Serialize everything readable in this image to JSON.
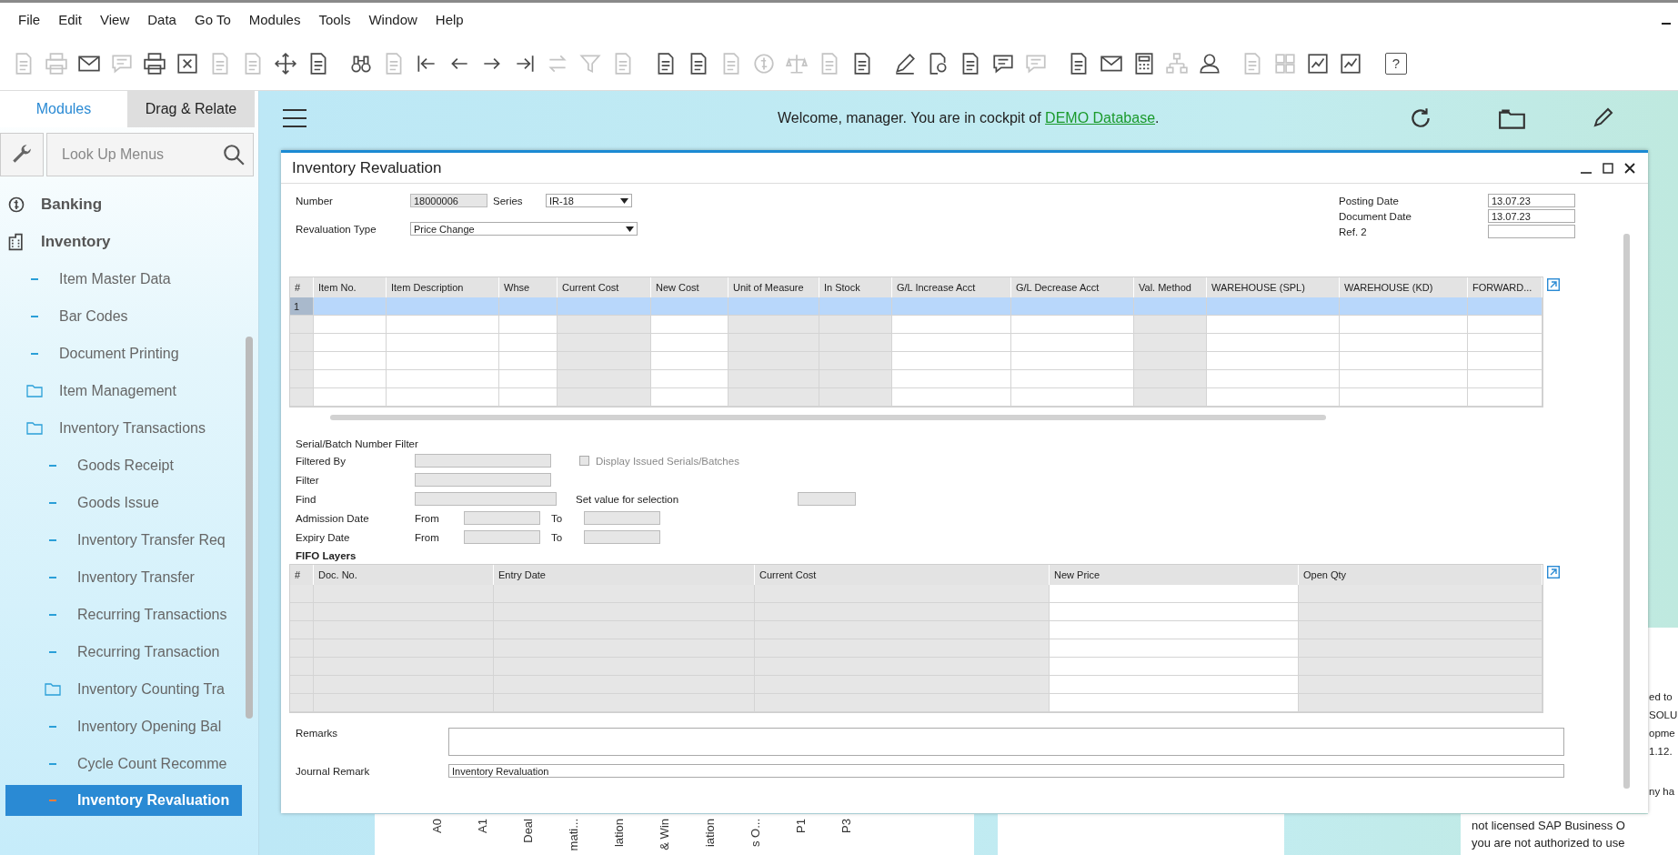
{
  "menu": [
    "File",
    "Edit",
    "View",
    "Data",
    "Go To",
    "Modules",
    "Tools",
    "Window",
    "Help"
  ],
  "toolbar": {
    "groups": [
      [
        {
          "disabled": true
        },
        {
          "disabled": true
        },
        {
          "disabled": false
        },
        {
          "disabled": true
        },
        {
          "disabled": false
        },
        {
          "disabled": false
        },
        {
          "disabled": true
        },
        {
          "disabled": true
        },
        {
          "disabled": false
        },
        {
          "disabled": false
        }
      ],
      [
        {
          "disabled": false
        },
        {
          "disabled": true
        },
        {
          "disabled": false
        },
        {
          "disabled": false
        },
        {
          "disabled": false
        },
        {
          "disabled": false
        },
        {
          "disabled": true
        },
        {
          "disabled": true
        },
        {
          "disabled": true
        }
      ],
      [
        {
          "disabled": false
        },
        {
          "disabled": false
        },
        {
          "disabled": true
        },
        {
          "disabled": true
        },
        {
          "disabled": true
        },
        {
          "disabled": true
        },
        {
          "disabled": false
        }
      ],
      [
        {
          "disabled": false
        },
        {
          "disabled": false
        },
        {
          "disabled": false
        },
        {
          "disabled": false
        },
        {
          "disabled": true
        }
      ],
      [
        {
          "disabled": false
        },
        {
          "disabled": false
        },
        {
          "disabled": false
        },
        {
          "disabled": true
        },
        {
          "disabled": false
        }
      ],
      [
        {
          "disabled": true
        },
        {
          "disabled": true
        },
        {
          "disabled": false
        },
        {
          "disabled": false
        }
      ],
      [
        {
          "disabled": false,
          "glyph": "?"
        }
      ]
    ]
  },
  "sidebar": {
    "tabs": [
      {
        "label": "Modules",
        "selected": true
      },
      {
        "label": "Drag & Relate",
        "selected": false
      }
    ],
    "search": {
      "placeholder": "Look Up Menus"
    },
    "modules": [
      {
        "label": "Banking",
        "kind": "coin",
        "selected": false
      },
      {
        "label": "Inventory",
        "kind": "building",
        "selected": false,
        "children": [
          {
            "label": "Item Master Data",
            "kind": "leaf",
            "selected": false
          },
          {
            "label": "Bar Codes",
            "kind": "leaf",
            "selected": false
          },
          {
            "label": "Document Printing",
            "kind": "leaf",
            "selected": false
          },
          {
            "label": "Item Management",
            "kind": "folder",
            "selected": false
          },
          {
            "label": "Inventory Transactions",
            "kind": "folder",
            "selected": false,
            "children": [
              {
                "label": "Goods Receipt",
                "kind": "leaf",
                "selected": false
              },
              {
                "label": "Goods Issue",
                "kind": "leaf",
                "selected": false
              },
              {
                "label": "Inventory Transfer Req",
                "kind": "leaf",
                "selected": false
              },
              {
                "label": "Inventory Transfer",
                "kind": "leaf",
                "selected": false
              },
              {
                "label": "Recurring Transactions",
                "kind": "leaf",
                "selected": false
              },
              {
                "label": "Recurring Transaction",
                "kind": "leaf",
                "selected": false
              },
              {
                "label": "Inventory Counting Tra",
                "kind": "folder",
                "selected": false
              },
              {
                "label": "Inventory Opening Bal",
                "kind": "leaf",
                "selected": false
              },
              {
                "label": "Cycle Count Recomme",
                "kind": "leaf",
                "selected": false
              },
              {
                "label": "Inventory Revaluation",
                "kind": "leaf",
                "selected": true
              }
            ]
          }
        ]
      }
    ]
  },
  "cockpit": {
    "welcome": {
      "text": "Welcome, manager. You are in cockpit of",
      "link": "DEMO Database",
      "end": "."
    },
    "chart_labels": [
      "A0",
      "A1",
      "Deal",
      "mati...",
      "lation",
      "& Win",
      "iation",
      "s O...",
      "P1",
      "P3"
    ],
    "notice_lines": [
      "ed to",
      "SOLU",
      "opme",
      "1.12.",
      "ny ha"
    ],
    "message_lines": [
      "not licensed SAP Business O",
      "you are not authorized to use"
    ]
  },
  "form": {
    "title": "Inventory Revaluation",
    "number": {
      "label": "Number",
      "value": "18000006",
      "disabled": true
    },
    "series": {
      "label": "Series",
      "value": "IR-18",
      "disabled": false
    },
    "revaluation_type": {
      "label": "Revaluation Type",
      "value": "Price Change",
      "disabled": false
    },
    "posting_date": {
      "label": "Posting Date",
      "value": "13.07.23"
    },
    "document_date": {
      "label": "Document Date",
      "value": "13.07.23"
    },
    "ref_2": {
      "label": "Ref. 2"
    },
    "items_table": {
      "columns": [
        {
          "label": "#",
          "disabled": true
        },
        {
          "label": "Item No.",
          "disabled": false
        },
        {
          "label": "Item Description",
          "disabled": false
        },
        {
          "label": "Whse",
          "disabled": false
        },
        {
          "label": "Current Cost",
          "disabled": true
        },
        {
          "label": "New Cost",
          "disabled": false
        },
        {
          "label": "Unit of Measure",
          "disabled": true
        },
        {
          "label": "In Stock",
          "disabled": true
        },
        {
          "label": "G/L Increase Acct",
          "disabled": false
        },
        {
          "label": "G/L Decrease Acct",
          "disabled": false
        },
        {
          "label": "Val. Method",
          "disabled": true
        },
        {
          "label": "WAREHOUSE (SPL)",
          "disabled": false
        },
        {
          "label": "WAREHOUSE (KD)",
          "disabled": false
        },
        {
          "label": "FORWARD...",
          "disabled": false
        }
      ],
      "rows": [
        {
          "number": "1",
          "selected": true
        },
        {
          "selected": false
        },
        {
          "selected": false
        },
        {
          "selected": false
        },
        {
          "selected": false
        },
        {
          "selected": false
        }
      ]
    },
    "filter": {
      "title": "Serial/Batch Number Filter",
      "filtered_by": {
        "label": "Filtered By",
        "disabled": true
      },
      "filter": {
        "label": "Filter",
        "disabled": true
      },
      "find": {
        "label": "Find",
        "disabled": true
      },
      "issued_checkbox": {
        "label": "Display Issued Serials/Batches",
        "checked": false,
        "disabled": true
      },
      "set_value": {
        "label": "Set value for selection",
        "disabled": true
      },
      "admission_date": {
        "label": "Admission Date",
        "from": "From",
        "to": "To",
        "disabled": true
      },
      "expiry_date": {
        "label": "Expiry Date",
        "from": "From",
        "to": "To",
        "disabled": true
      }
    },
    "fifo": {
      "title": "FIFO Layers",
      "columns": [
        {
          "label": "#",
          "disabled": true
        },
        {
          "label": "Doc. No.",
          "disabled": true
        },
        {
          "label": "Entry Date",
          "disabled": true
        },
        {
          "label": "Current Cost",
          "disabled": true
        },
        {
          "label": "New Price",
          "disabled": false
        },
        {
          "label": "Open Qty",
          "disabled": true
        }
      ],
      "rows": [
        {
          "selected": false
        },
        {
          "selected": false
        },
        {
          "selected": false
        },
        {
          "selected": false
        },
        {
          "selected": false
        },
        {
          "selected": false
        },
        {
          "selected": false
        }
      ]
    },
    "remarks": {
      "label": "Remarks"
    },
    "journal_remark": {
      "label": "Journal Remark",
      "value": "Inventory Revaluation"
    }
  }
}
